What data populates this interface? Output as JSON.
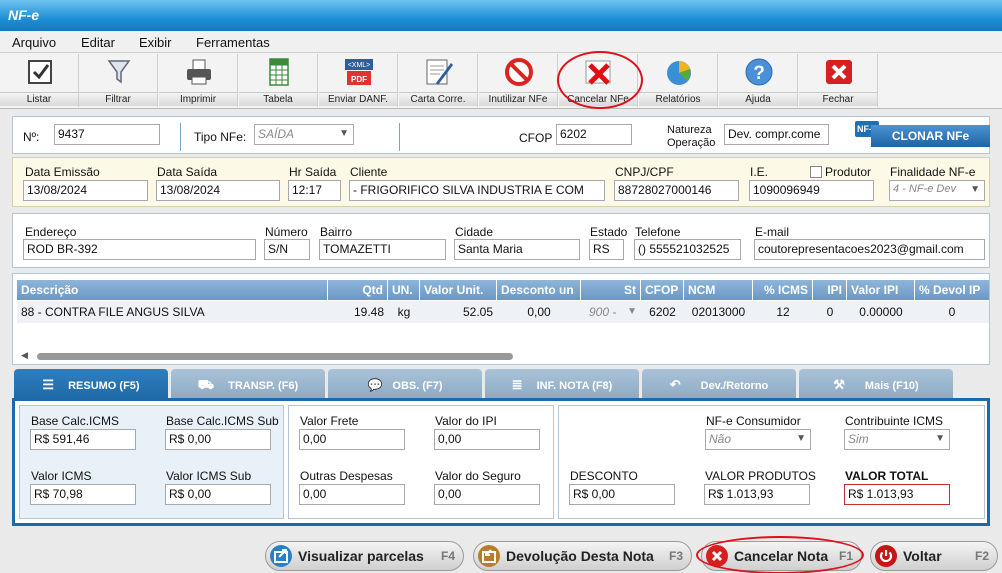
{
  "app": {
    "title": "NF-e"
  },
  "menu": [
    "Arquivo",
    "Editar",
    "Exibir",
    "Ferramentas"
  ],
  "toolbar": [
    {
      "label": "Listar",
      "icon": "checklist-icon"
    },
    {
      "label": "Filtrar",
      "icon": "filter-icon"
    },
    {
      "label": "Imprimir",
      "icon": "printer-icon"
    },
    {
      "label": "Tabela",
      "icon": "spreadsheet-icon"
    },
    {
      "label": "Enviar DANF.",
      "icon": "xml-pdf-icon",
      "badge_top": "<XML>",
      "badge_bottom": "PDF"
    },
    {
      "label": "Carta Corre.",
      "icon": "letter-pen-icon"
    },
    {
      "label": "Inutilizar NFe",
      "icon": "prohibited-icon"
    },
    {
      "label": "Cancelar NFe",
      "icon": "cancel-x-icon"
    },
    {
      "label": "Relatórios",
      "icon": "pie-chart-icon"
    },
    {
      "label": "Ajuda",
      "icon": "help-icon",
      "glyph": "?"
    },
    {
      "label": "Fechar",
      "icon": "close-icon"
    }
  ],
  "header": {
    "num_label": "Nº:",
    "num": "9437",
    "tipo_label": "Tipo NFe:",
    "tipo": "SAÍDA",
    "cfop_label": "CFOP",
    "cfop": "6202",
    "natureza_label1": "Natureza",
    "natureza_label2": "Operação",
    "natureza": "Dev. compr.come",
    "clone_badge": "NF-e",
    "clone_label": "CLONAR NFe"
  },
  "row2": {
    "data_emissao_label": "Data Emissão",
    "data_emissao": "13/08/2024",
    "data_saida_label": "Data Saída",
    "data_saida": "13/08/2024",
    "hr_saida_label": "Hr Saída",
    "hr_saida": "12:17",
    "cliente_label": "Cliente",
    "cliente": "- FRIGORIFICO SILVA INDUSTRIA E COM",
    "cnpj_label": "CNPJ/CPF",
    "cnpj": "88728027000146",
    "ie_label": "I.E.",
    "ie": "1090096949",
    "produtor_label": "Produtor",
    "finalidade_label": "Finalidade NF-e",
    "finalidade": "4 - NF-e Dev"
  },
  "row3": {
    "endereco_label": "Endereço",
    "endereco": "ROD BR-392",
    "numero_label": "Número",
    "numero": "S/N",
    "bairro_label": "Bairro",
    "bairro": "TOMAZETTI",
    "cidade_label": "Cidade",
    "cidade": "Santa Maria",
    "estado_label": "Estado",
    "estado": "RS",
    "telefone_label": "Telefone",
    "telefone": "() 555521032525",
    "email_label": "E-mail",
    "email": "coutorepresentacoes2023@gmail.com"
  },
  "items": {
    "columns": [
      "Descrição",
      "Qtd",
      "UN.",
      "Valor Unit.",
      "Desconto un",
      "St",
      "CFOP",
      "NCM",
      "% ICMS",
      "IPI",
      "Valor IPI",
      "% Devol IP"
    ],
    "row": [
      "88 - CONTRA FILE ANGUS SILVA",
      "19.48",
      "kg",
      "52.05",
      "0,00",
      "900 -",
      "6202",
      "02013000",
      "12",
      "0",
      "0.00000",
      "0"
    ]
  },
  "tabs": [
    {
      "label": "RESUMO (F5)",
      "icon": "list-icon",
      "glyph": "☰"
    },
    {
      "label": "TRANSP. (F6)",
      "icon": "truck-icon",
      "glyph": "⛟"
    },
    {
      "label": "OBS. (F7)",
      "icon": "chat-icon",
      "glyph": "💬"
    },
    {
      "label": "INF. NOTA (F8)",
      "icon": "database-icon",
      "glyph": "≣"
    },
    {
      "label": "Dev./Retorno",
      "icon": "return-icon",
      "glyph": "↶"
    },
    {
      "label": "Mais (F10)",
      "icon": "tools-icon",
      "glyph": "⚒"
    }
  ],
  "resumo": {
    "base_icms_label": "Base Calc.ICMS",
    "base_icms": "R$ 591,46",
    "base_icms_sub_label": "Base Calc.ICMS Sub",
    "base_icms_sub": "R$ 0,00",
    "valor_icms_label": "Valor ICMS",
    "valor_icms": "R$ 70,98",
    "valor_icms_sub_label": "Valor ICMS Sub",
    "valor_icms_sub": "R$ 0,00",
    "frete_label": "Valor Frete",
    "frete": "0,00",
    "ipi_label": "Valor do IPI",
    "ipi": "0,00",
    "outras_label": "Outras Despesas",
    "outras": "0,00",
    "seguro_label": "Valor do Seguro",
    "seguro": "0,00",
    "consumidor_label": "NF-e Consumidor",
    "consumidor": "Não",
    "contribuinte_label": "Contribuinte ICMS",
    "contribuinte": "Sim",
    "desconto_label": "DESCONTO",
    "desconto": "R$ 0,00",
    "produtos_label": "VALOR PRODUTOS",
    "produtos": "R$ 1.013,93",
    "total_label": "VALOR TOTAL",
    "total": "R$ 1.013,93"
  },
  "buttons": [
    {
      "label": "Visualizar parcelas",
      "key": "F4",
      "icon": "export-icon",
      "color": "#2d7fc4"
    },
    {
      "label": "Devolução Desta Nota",
      "key": "F3",
      "icon": "return-box-icon",
      "color": "#b77d2a"
    },
    {
      "label": "Cancelar Nota",
      "key": "F1",
      "icon": "cancel-icon",
      "color": "#d91e1e"
    },
    {
      "label": "Voltar",
      "key": "F2",
      "icon": "power-icon",
      "color": "#c81414"
    }
  ],
  "colors": {
    "annotation_red": "#e0101a",
    "accent_blue": "#1f69a8"
  }
}
